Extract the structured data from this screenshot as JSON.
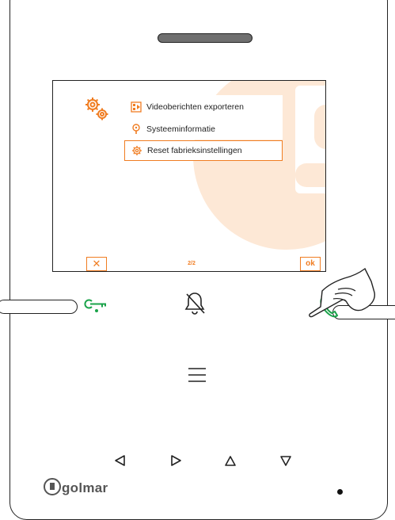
{
  "screen": {
    "menu": [
      {
        "label": "Videoberichten exporteren",
        "icon": "video-export-icon"
      },
      {
        "label": "Systeeminformatie",
        "icon": "info-icon"
      },
      {
        "label": "Reset fabrieksinstellingen",
        "icon": "reset-gear-icon",
        "selected": true
      }
    ],
    "footer": {
      "cancel_label": "✕",
      "page_indicator": "2/2",
      "ok_label": "ok"
    },
    "watermark": "g"
  },
  "device": {
    "logo": "golmar",
    "buttons": [
      "key-icon",
      "bell-muted-icon",
      "phone-icon",
      "menu-icon",
      "triangle-left-icon",
      "triangle-right-icon",
      "triangle-up-icon",
      "triangle-down-icon"
    ]
  },
  "colors": {
    "accent": "#f07d22",
    "green": "#1aa34a",
    "watermark": "#fde8d6",
    "outline": "#222222"
  }
}
